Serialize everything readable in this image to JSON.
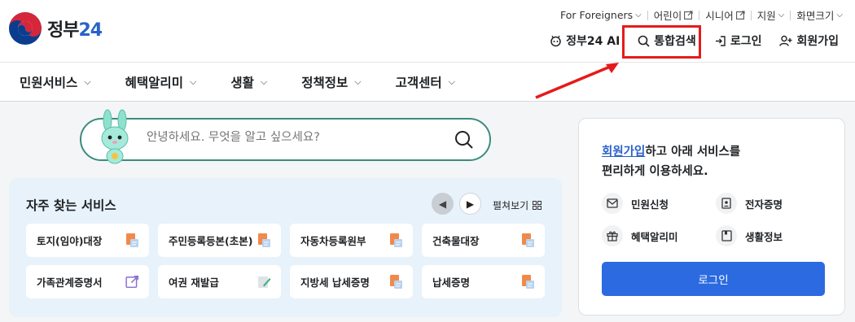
{
  "logo": {
    "name": "정부",
    "num": "24"
  },
  "util": {
    "foreign": "For Foreigners",
    "kids": "어린이",
    "senior": "시니어",
    "support": "지원",
    "zoom": "화면크기"
  },
  "gnb": {
    "ai": "정부24 AI",
    "search": "통합검색",
    "login": "로그인",
    "join": "회원가입"
  },
  "nav": [
    {
      "label": "민원서비스"
    },
    {
      "label": "혜택알리미"
    },
    {
      "label": "생활"
    },
    {
      "label": "정책정보"
    },
    {
      "label": "고객센터"
    }
  ],
  "search": {
    "placeholder": "안녕하세요. 무엇을 알고 싶으세요?"
  },
  "panel": {
    "title": "자주 찾는 서비스",
    "expand": "펼쳐보기",
    "cards": [
      {
        "label": "토지(임야)대장",
        "icon": "document-icon"
      },
      {
        "label": "주민등록등본(초본)",
        "icon": "document-icon"
      },
      {
        "label": "자동차등록원부",
        "icon": "document-icon"
      },
      {
        "label": "건축물대장",
        "icon": "document-icon"
      },
      {
        "label": "가족관계증명서",
        "icon": "external-link-icon"
      },
      {
        "label": "여권 재발급",
        "icon": "edit-icon"
      },
      {
        "label": "지방세 납세증명",
        "icon": "document-icon"
      },
      {
        "label": "납세증명",
        "icon": "document-icon"
      }
    ]
  },
  "side": {
    "link": "회원가입",
    "line1_rest": "하고 아래 서비스를",
    "line2": "편리하게 이용하세요.",
    "services": [
      {
        "label": "민원신청",
        "icon": "mail-icon"
      },
      {
        "label": "전자증명",
        "icon": "certificate-icon"
      },
      {
        "label": "혜택알리미",
        "icon": "gift-icon"
      },
      {
        "label": "생활정보",
        "icon": "book-icon"
      }
    ],
    "login": "로그인"
  },
  "colors": {
    "accent": "#2b6ae0",
    "highlight": "#e51b1b",
    "search_border": "#3b8c7c",
    "panel_bg": "#e8f2fb"
  }
}
